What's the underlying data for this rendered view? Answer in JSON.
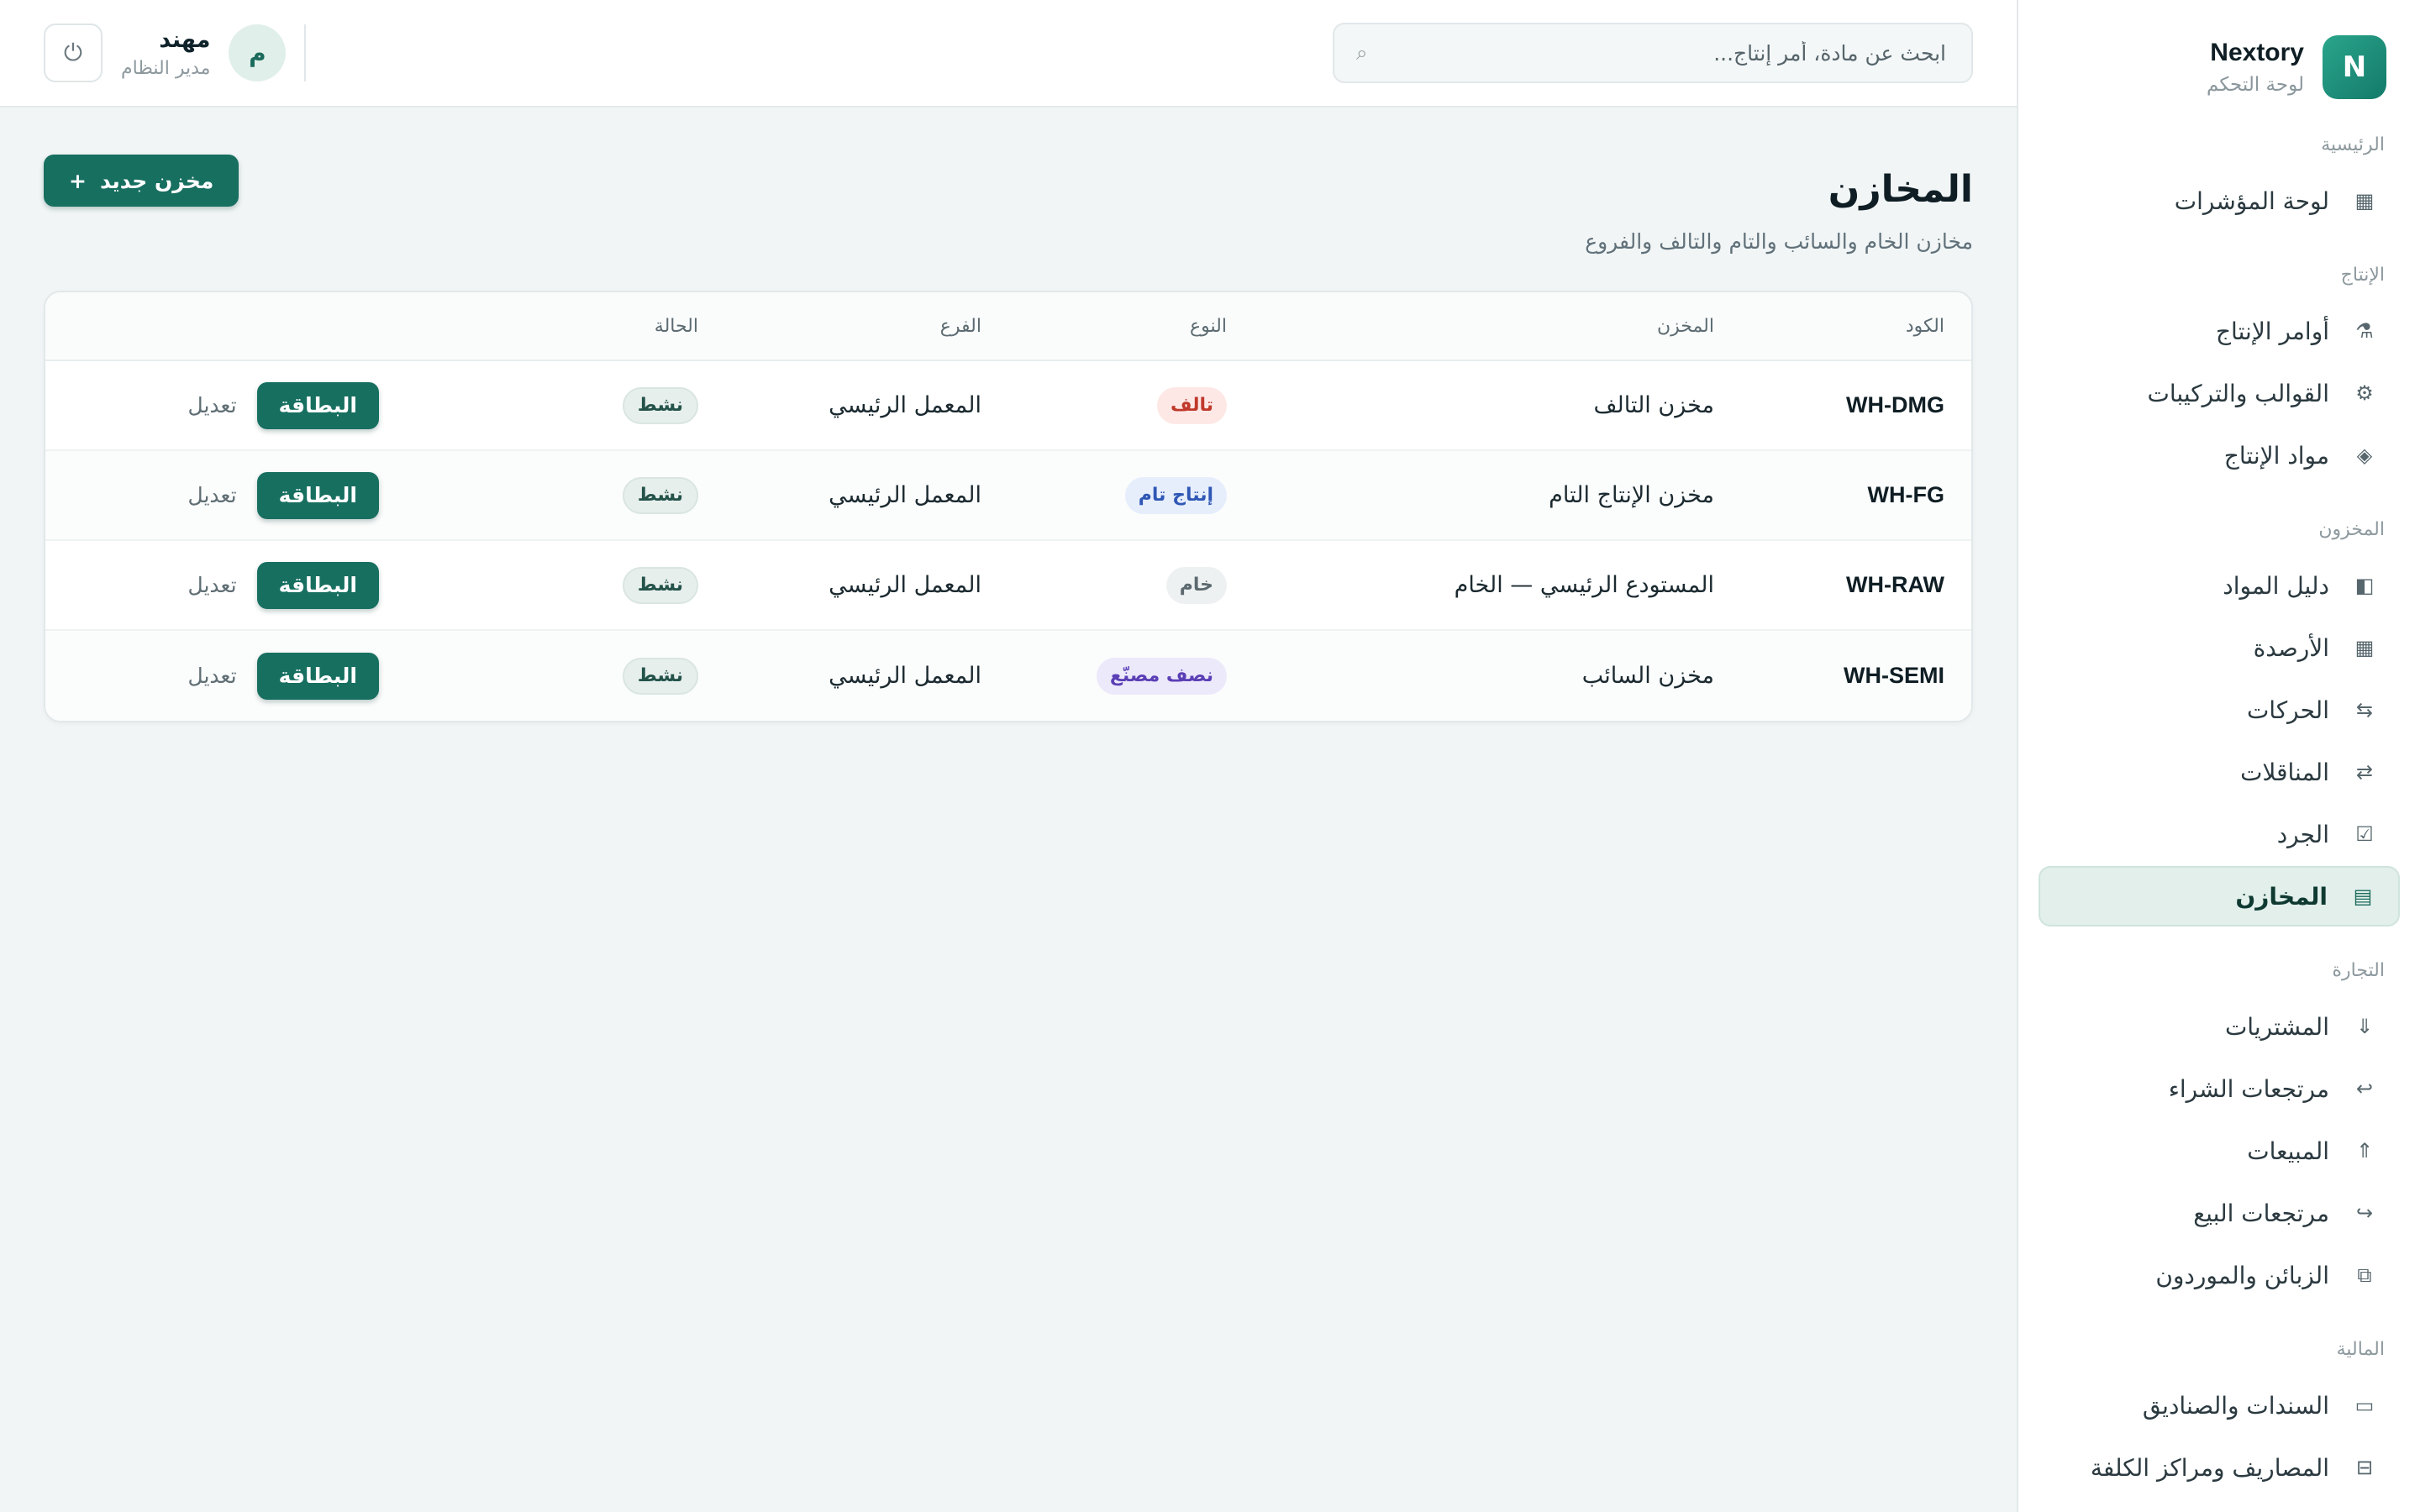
{
  "brand": {
    "logo_letter": "N",
    "name": "Nextory",
    "subtitle": "لوحة التحكم"
  },
  "sidebar": {
    "sections": [
      {
        "title": "الرئيسية",
        "items": [
          {
            "label": "لوحة المؤشرات",
            "icon": "▦",
            "icon_name": "grid-icon"
          }
        ]
      },
      {
        "title": "الإنتاج",
        "items": [
          {
            "label": "أوامر الإنتاج",
            "icon": "⚗",
            "icon_name": "flask-icon"
          },
          {
            "label": "القوالب والتركيبات",
            "icon": "⚙",
            "icon_name": "gear-icon"
          },
          {
            "label": "مواد الإنتاج",
            "icon": "◈",
            "icon_name": "diamond-icon"
          }
        ]
      },
      {
        "title": "المخزون",
        "items": [
          {
            "label": "دليل المواد",
            "icon": "◧",
            "icon_name": "book-icon"
          },
          {
            "label": "الأرصدة",
            "icon": "▦",
            "icon_name": "table-icon"
          },
          {
            "label": "الحركات",
            "icon": "⇆",
            "icon_name": "movements-icon"
          },
          {
            "label": "المناقلات",
            "icon": "⇄",
            "icon_name": "transfer-icon"
          },
          {
            "label": "الجرد",
            "icon": "☑",
            "icon_name": "checkbox-icon"
          },
          {
            "label": "المخازن",
            "icon": "▤",
            "icon_name": "warehouse-icon",
            "active": true
          }
        ]
      },
      {
        "title": "التجارة",
        "items": [
          {
            "label": "المشتريات",
            "icon": "⇓",
            "icon_name": "arrow-down-icon"
          },
          {
            "label": "مرتجعات الشراء",
            "icon": "↩",
            "icon_name": "return-icon"
          },
          {
            "label": "المبيعات",
            "icon": "⇑",
            "icon_name": "arrow-up-icon"
          },
          {
            "label": "مرتجعات البيع",
            "icon": "↪",
            "icon_name": "return-sale-icon"
          },
          {
            "label": "الزبائن والموردون",
            "icon": "⧉",
            "icon_name": "contacts-icon"
          }
        ]
      },
      {
        "title": "المالية",
        "items": [
          {
            "label": "السندات والصناديق",
            "icon": "▭",
            "icon_name": "cash-icon"
          },
          {
            "label": "المصاريف ومراكز الكلفة",
            "icon": "⊟",
            "icon_name": "expenses-icon"
          }
        ]
      }
    ]
  },
  "topbar": {
    "search_placeholder": "ابحث عن مادة، أمر إنتاج...",
    "user": {
      "avatar_letter": "م",
      "name": "مهند",
      "role": "مدير النظام"
    },
    "power_icon": "⏻"
  },
  "page": {
    "title": "المخازن",
    "subtitle": "مخازن الخام والسائب والتام والتالف والفروع",
    "new_button_label": "مخزن جديد",
    "new_button_icon": "+"
  },
  "table": {
    "headers": {
      "code": "الكود",
      "name": "المخزن",
      "type": "النوع",
      "branch": "الفرع",
      "status": "الحالة"
    },
    "rows": [
      {
        "code": "WH-DMG",
        "name": "مخزن التالف",
        "type": "تالف",
        "type_bg": "#fde8e6",
        "type_color": "#c0392b",
        "branch": "المعمل الرئيسي",
        "status": "نشط",
        "card_label": "البطاقة",
        "edit_label": "تعديل"
      },
      {
        "code": "WH-FG",
        "name": "مخزن الإنتاج التام",
        "type": "إنتاج تام",
        "type_bg": "#e6eefc",
        "type_color": "#2f57b5",
        "branch": "المعمل الرئيسي",
        "status": "نشط",
        "card_label": "البطاقة",
        "edit_label": "تعديل"
      },
      {
        "code": "WH-RAW",
        "name": "المستودع الرئيسي — الخام",
        "type": "خام",
        "type_bg": "#eef1f2",
        "type_color": "#5c6a70",
        "branch": "المعمل الرئيسي",
        "status": "نشط",
        "card_label": "البطاقة",
        "edit_label": "تعديل"
      },
      {
        "code": "WH-SEMI",
        "name": "مخزن السائب",
        "type": "نصف مصنّع",
        "type_bg": "#ece9fb",
        "type_color": "#5b3fb5",
        "branch": "المعمل الرئيسي",
        "status": "نشط",
        "card_label": "البطاقة",
        "edit_label": "تعديل"
      }
    ]
  },
  "colors": {
    "accent": "#176f60",
    "active_nav_bg": "#e2efeb",
    "page_bg": "#f1f5f6"
  }
}
